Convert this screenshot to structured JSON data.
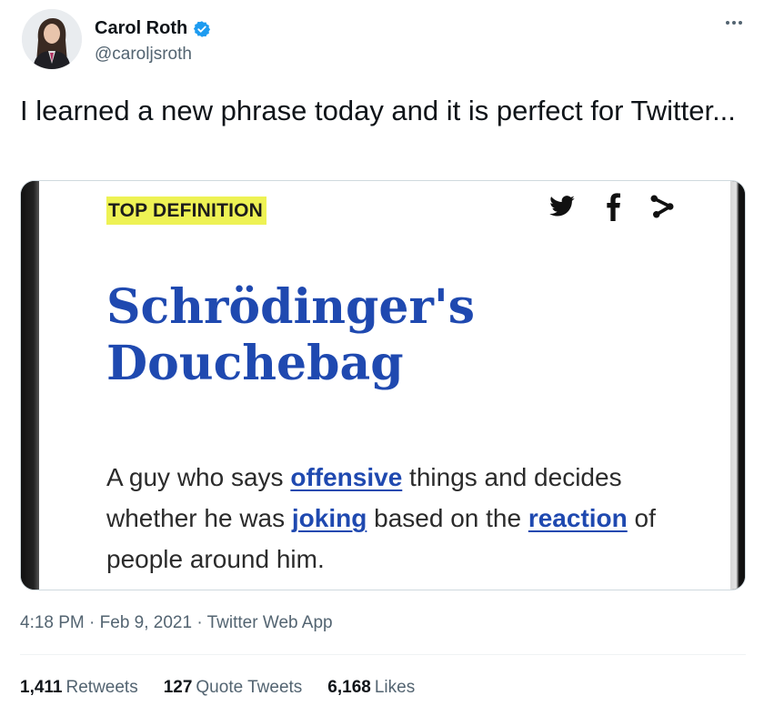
{
  "author": {
    "display_name": "Carol Roth",
    "handle": "@caroljsroth",
    "verified_color": "#1d9bf0"
  },
  "tweet": {
    "text": "I learned a new phrase today and it is perfect for Twitter..."
  },
  "media": {
    "top_definition_label": "TOP DEFINITION",
    "share_icons": [
      "twitter-bird-icon",
      "facebook-icon",
      "share-icon"
    ],
    "word_line1": "Schrödinger's",
    "word_line2": "Douchebag",
    "definition": {
      "part1": "A guy who says ",
      "link1": "offensive",
      "part2": " things and decides whether he was ",
      "link2": "joking",
      "part3": " based on the ",
      "link3": "reaction",
      "part4": " of people around him."
    },
    "highlight_color": "#eef254",
    "word_color": "#1f49b0"
  },
  "meta": {
    "time": "4:18 PM",
    "separator1": " · ",
    "date": "Feb 9, 2021",
    "separator2": " · ",
    "source": "Twitter Web App"
  },
  "stats": {
    "retweets_count": "1,411",
    "retweets_label": "Retweets",
    "quotes_count": "127",
    "quotes_label": "Quote Tweets",
    "likes_count": "6,168",
    "likes_label": "Likes"
  }
}
